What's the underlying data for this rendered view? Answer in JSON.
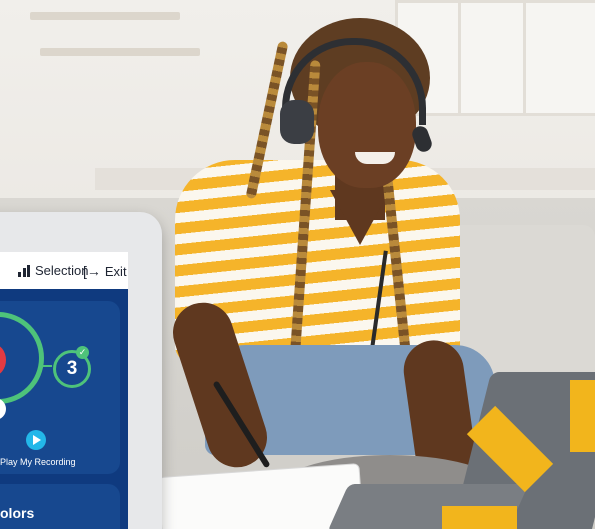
{
  "tablet_app": {
    "header": {
      "selection_label": "Selection",
      "exit_label": "Exit",
      "selection_icon": "bar-chart-icon",
      "exit_icon": "exit-arrow-icon"
    },
    "progress": {
      "current_step": "3",
      "step_complete_icon": "checkmark-icon"
    },
    "playback": {
      "label": "Play My Recording",
      "icon": "play-icon"
    },
    "next_card": {
      "title_fragment": "olors"
    }
  },
  "colors": {
    "brand_yellow": "#f2b51c",
    "app_navy": "#0f3a7f",
    "progress_green": "#4ec37a",
    "record_red": "#e23a42",
    "play_cyan": "#23b7e9"
  },
  "scene_objects": [
    "headphones-icon",
    "notebook",
    "pen",
    "laptop"
  ]
}
